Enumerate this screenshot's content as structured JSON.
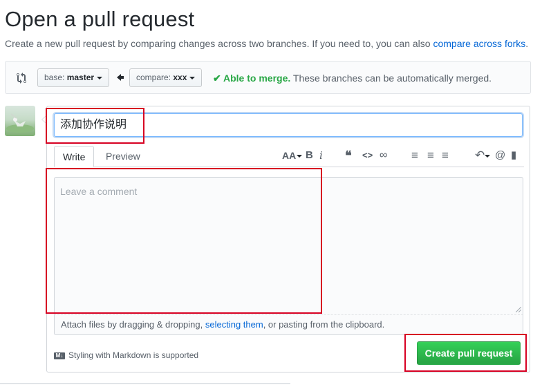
{
  "page": {
    "title": "Open a pull request",
    "subtitle_text": "Create a new pull request by comparing changes across two branches. If you need to, you can also ",
    "subtitle_link": "compare across forks",
    "subtitle_end": "."
  },
  "compare": {
    "base_prefix": "base: ",
    "base_branch": "master",
    "compare_prefix": "compare: ",
    "compare_branch": "xxx",
    "merge_ok": "Able to merge.",
    "merge_desc": " These branches can be automatically merged."
  },
  "form": {
    "title_value": "添加协作说明",
    "tab_write": "Write",
    "tab_preview": "Preview",
    "comment_placeholder": "Leave a comment",
    "attach_text_1": "Attach files by dragging & dropping, ",
    "attach_link": "selecting them",
    "attach_text_2": ", or pasting from the clipboard.",
    "markdown_note": "Styling with Markdown is supported",
    "md_badge": "M↓",
    "submit_label": "Create pull request"
  },
  "toolbar": {
    "icons": [
      "header-icon",
      "bold-icon",
      "italic-icon",
      "quote-icon",
      "code-icon",
      "link-icon",
      "unordered-list-icon",
      "ordered-list-icon",
      "task-list-icon",
      "reply-icon",
      "mention-icon",
      "bookmark-icon"
    ],
    "glyphs": {
      "header": "AA",
      "bold": "B",
      "italic": "i",
      "quote": "❝",
      "code": "<>",
      "link": "∞",
      "ul": "≡",
      "ol": "≡",
      "task": "≡",
      "reply": "↶",
      "mention": "@",
      "bookmark": "▮"
    }
  },
  "colors": {
    "link": "#0366d6",
    "success": "#28a745",
    "annotation": "#d70022"
  }
}
